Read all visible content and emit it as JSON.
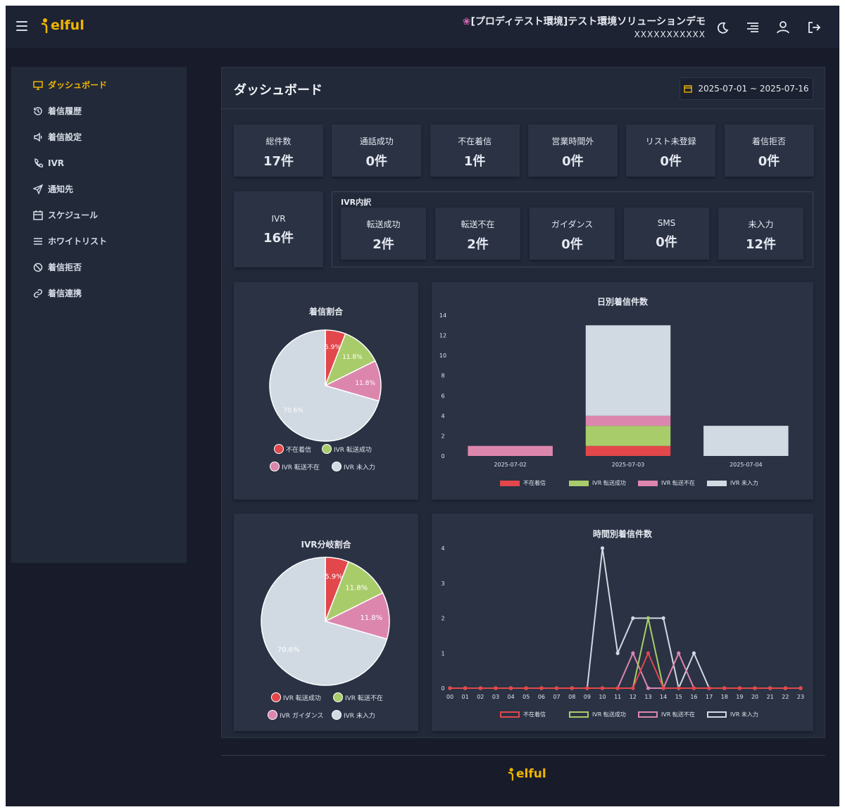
{
  "header": {
    "logo_text": "elful",
    "env_title": "[プロディテスト環境]テスト環境ソリューションデモ",
    "env_sub": "XXXXXXXXXXX",
    "icons": [
      "menu-icon",
      "moon-icon",
      "list-icon",
      "user-icon",
      "logout-icon"
    ]
  },
  "sidebar": {
    "items": [
      {
        "label": "ダッシュボード",
        "icon": "monitor-icon",
        "active": true
      },
      {
        "label": "着信履歴",
        "icon": "history-icon"
      },
      {
        "label": "着信設定",
        "icon": "speaker-icon"
      },
      {
        "label": "IVR",
        "icon": "phone-icon"
      },
      {
        "label": "通知先",
        "icon": "send-icon"
      },
      {
        "label": "スケジュール",
        "icon": "calendar-icon"
      },
      {
        "label": "ホワイトリスト",
        "icon": "list-icon"
      },
      {
        "label": "着信拒否",
        "icon": "ban-icon"
      },
      {
        "label": "着信連携",
        "icon": "link-icon"
      }
    ]
  },
  "main": {
    "title": "ダッシュボード",
    "date_range": "2025-07-01 ~ 2025-07-16",
    "stats": [
      {
        "label": "総件数",
        "value": "17件"
      },
      {
        "label": "通話成功",
        "value": "0件"
      },
      {
        "label": "不在着信",
        "value": "1件"
      },
      {
        "label": "営業時間外",
        "value": "0件"
      },
      {
        "label": "リスト未登録",
        "value": "0件"
      },
      {
        "label": "着信拒否",
        "value": "0件"
      }
    ],
    "ivr": {
      "label": "IVR",
      "value": "16件"
    },
    "ivr_breakdown": {
      "header": "IVR内訳",
      "items": [
        {
          "label": "転送成功",
          "value": "2件"
        },
        {
          "label": "転送不在",
          "value": "2件"
        },
        {
          "label": "ガイダンス",
          "value": "0件"
        },
        {
          "label": "SMS",
          "value": "0件"
        },
        {
          "label": "未入力",
          "value": "12件"
        }
      ]
    }
  },
  "colors": {
    "red": "#e2474b",
    "green": "#a9cc6a",
    "pink": "#dc86ae",
    "gray": "#d1d9e2",
    "accent": "#f0b400"
  },
  "chart_data": [
    {
      "type": "pie",
      "title": "着信割合",
      "labels": [
        "不在着信",
        "IVR 転送成功",
        "IVR 転送不在",
        "IVR 未入力"
      ],
      "values": [
        5.9,
        11.8,
        11.8,
        70.6
      ],
      "value_labels": [
        "5.9%",
        "11.8%",
        "11.8%",
        "70.6%"
      ],
      "colors": [
        "#e2474b",
        "#a9cc6a",
        "#dc86ae",
        "#d1d9e2"
      ]
    },
    {
      "type": "bar",
      "title": "日別着信件数",
      "categories": [
        "2025-07-02",
        "2025-07-03",
        "2025-07-04"
      ],
      "stacked": true,
      "ylim": [
        0,
        14
      ],
      "yticks": [
        "0",
        "2",
        "4",
        "6",
        "8",
        "10",
        "12",
        "14"
      ],
      "series": [
        {
          "name": "不在着信",
          "color": "#e2474b",
          "values": [
            0,
            1,
            0
          ]
        },
        {
          "name": "IVR 転送成功",
          "color": "#a9cc6a",
          "values": [
            0,
            2,
            0
          ]
        },
        {
          "name": "IVR 転送不在",
          "color": "#dc86ae",
          "values": [
            1,
            1,
            0
          ]
        },
        {
          "name": "IVR 未入力",
          "color": "#d1d9e2",
          "values": [
            0,
            9,
            3
          ]
        }
      ]
    },
    {
      "type": "pie",
      "title": "IVR分岐割合",
      "labels": [
        "IVR 転送成功",
        "IVR 転送不在",
        "IVR ガイダンス",
        "IVR 未入力"
      ],
      "values": [
        5.9,
        11.8,
        11.8,
        70.6
      ],
      "value_labels": [
        "5.9%",
        "11.8%",
        "11.8%",
        "70.6%"
      ],
      "colors": [
        "#e2474b",
        "#a9cc6a",
        "#dc86ae",
        "#d1d9e2"
      ]
    },
    {
      "type": "line",
      "title": "時間別着信件数",
      "x": [
        "00",
        "01",
        "02",
        "03",
        "04",
        "05",
        "06",
        "07",
        "08",
        "09",
        "10",
        "11",
        "12",
        "13",
        "14",
        "15",
        "16",
        "17",
        "18",
        "19",
        "20",
        "21",
        "22",
        "23"
      ],
      "ylim": [
        0,
        4
      ],
      "yticks": [
        "0",
        "1",
        "2",
        "3",
        "4"
      ],
      "series": [
        {
          "name": "不在着信",
          "color": "#e2474b",
          "values": [
            0,
            0,
            0,
            0,
            0,
            0,
            0,
            0,
            0,
            0,
            0,
            0,
            0,
            1,
            0,
            0,
            0,
            0,
            0,
            0,
            0,
            0,
            0,
            0
          ]
        },
        {
          "name": "IVR 転送成功",
          "color": "#a9cc6a",
          "values": [
            0,
            0,
            0,
            0,
            0,
            0,
            0,
            0,
            0,
            0,
            0,
            0,
            0,
            2,
            0,
            0,
            0,
            0,
            0,
            0,
            0,
            0,
            0,
            0
          ]
        },
        {
          "name": "IVR 転送不在",
          "color": "#dc86ae",
          "values": [
            0,
            0,
            0,
            0,
            0,
            0,
            0,
            0,
            0,
            0,
            0,
            0,
            1,
            0,
            0,
            1,
            0,
            0,
            0,
            0,
            0,
            0,
            0,
            0
          ]
        },
        {
          "name": "IVR 未入力",
          "color": "#d1d9e2",
          "values": [
            0,
            0,
            0,
            0,
            0,
            0,
            0,
            0,
            0,
            0,
            4,
            1,
            2,
            2,
            2,
            0,
            1,
            0,
            0,
            0,
            0,
            0,
            0,
            0
          ]
        }
      ]
    }
  ],
  "footer": {
    "logo_text": "elful"
  }
}
